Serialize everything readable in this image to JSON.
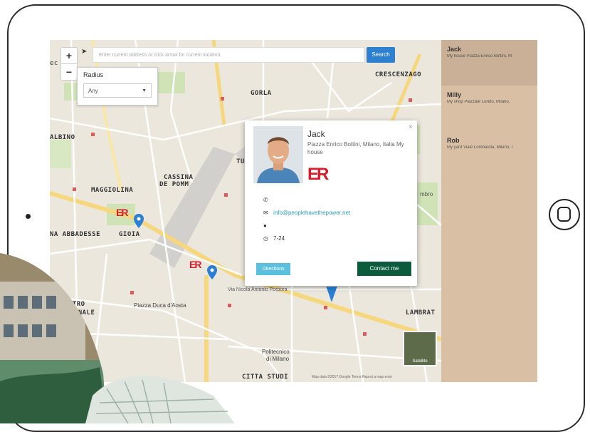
{
  "search": {
    "placeholder": "Enter current address or click arrow for current location",
    "button_label": "Search"
  },
  "zoom": {
    "in_label": "+",
    "out_label": "−"
  },
  "radius": {
    "label": "Radius",
    "selected": "Any"
  },
  "map_labels": {
    "crescenzago": "CRESCENZAGO",
    "gorla": "GORLA",
    "albino": "ALBINO",
    "cassina": "CASSINA",
    "de_pomm": "DE POMM",
    "maggiolina": "MAGGIOLINA",
    "abbadesse": "NA ABBADESSE",
    "gioia": "GIOIA",
    "centro": "ENTRO",
    "zionale": "ZIONALE",
    "piazza_duca": "Piazza Duca d'Aosta",
    "lambrate": "LAMBRAT",
    "politecnico": "Politecnico",
    "di_milano": "di Milano",
    "citta_studi": "CITTA STUDI",
    "via_nicola": "Via Nicola Antonio Porpora",
    "ec": "ec",
    "tu": "TU",
    "mbro": "mbro"
  },
  "popup": {
    "name": "Jack",
    "address": "Piazza Enrico Bottini, Milano, Italia My house",
    "logo_text": "ER",
    "email": "info@peoplehavethepower.net",
    "hours": "7-24",
    "directions_label": "Directions",
    "contact_label": "Contact me",
    "close": "×"
  },
  "satellite_label": "Satellite",
  "attribution": "Map data ©2017 Google   Terms  Report a map error",
  "list": [
    {
      "name": "Jack",
      "detail": "My house Piazza Enrico Bottini, M"
    },
    {
      "name": "Milly",
      "detail": "My shop Piazzale Loreto, Milano,"
    },
    {
      "name": "Rob",
      "detail": "My yard Viale Lombardia, Milano, I"
    }
  ],
  "colors": {
    "search_button": "#2d7fd0",
    "contact_button": "#0b5b3c",
    "directions_button": "#5bc0de",
    "sidebar": "#d9bfa4",
    "brand_red": "#d81e2c",
    "pin_blue": "#2a7fd4"
  },
  "icons": [
    "locate-arrow-icon",
    "phone-icon",
    "envelope-icon",
    "globe-icon",
    "clock-icon",
    "map-pin-icon"
  ]
}
